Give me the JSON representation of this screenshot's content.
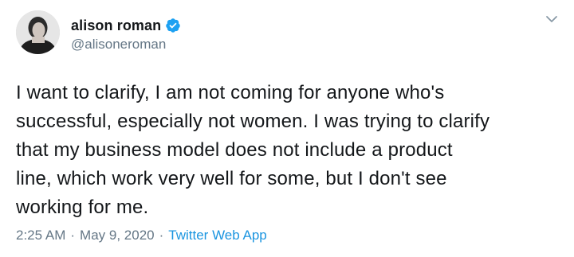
{
  "tweet": {
    "author": {
      "display_name": "alison roman",
      "handle": "@alisoneroman",
      "verified": true,
      "avatar_icon": "profile-photo",
      "verified_color": "#1da1f2"
    },
    "text": "I want to clarify, I am not coming for anyone who's\nsuccessful, especially not women. I was trying to clarify\nthat my business model does not include a product\nline, which work very well for some, but I don't see\nworking for me.",
    "time": "2:25 AM",
    "separator": "·",
    "date": "May 9, 2020",
    "source": "Twitter Web App",
    "source_color": "#1b95e0",
    "menu_icon": "chevron-down-icon"
  }
}
